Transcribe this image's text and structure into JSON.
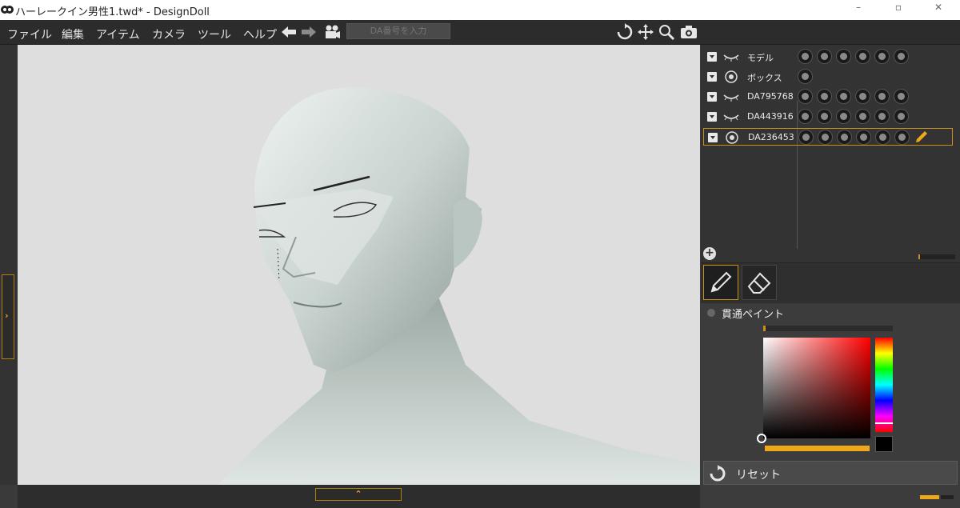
{
  "window": {
    "title": "ハーレークイン男性1.twd* - DesignDoll",
    "minimize": "–",
    "restore": "▫",
    "close": "✕"
  },
  "menu": {
    "items": [
      "ファイル",
      "編集",
      "アイテム",
      "カメラ",
      "ツール",
      "ヘルプ"
    ],
    "da_input_placeholder": "DA番号を入力"
  },
  "toolbar_icons": [
    "undo-arrow-icon",
    "redo-arrow-icon",
    "video-camera-icon",
    "rotate-icon",
    "move-icon",
    "zoom-icon",
    "camera-icon"
  ],
  "layers": [
    {
      "name": "モデル",
      "visibility": "eye-closed",
      "tool_count": 6,
      "selected": false
    },
    {
      "name": "ボックス",
      "visibility": "eye-open",
      "tool_count": 1,
      "selected": false
    },
    {
      "name": "DA795768",
      "visibility": "eye-closed",
      "tool_count": 6,
      "selected": false
    },
    {
      "name": "DA443916",
      "visibility": "eye-closed",
      "tool_count": 6,
      "selected": false
    },
    {
      "name": "DA236453",
      "visibility": "eye-open",
      "tool_count": 6,
      "selected": true
    }
  ],
  "paint": {
    "penetrate_label": "貫通ペイント",
    "selected_color": "#000000",
    "hue_color": "#ff0000"
  },
  "reset": {
    "label": "リセット"
  },
  "colors": {
    "accent": "#f0a81b",
    "panel": "#333333",
    "viewport": "#dedede"
  }
}
